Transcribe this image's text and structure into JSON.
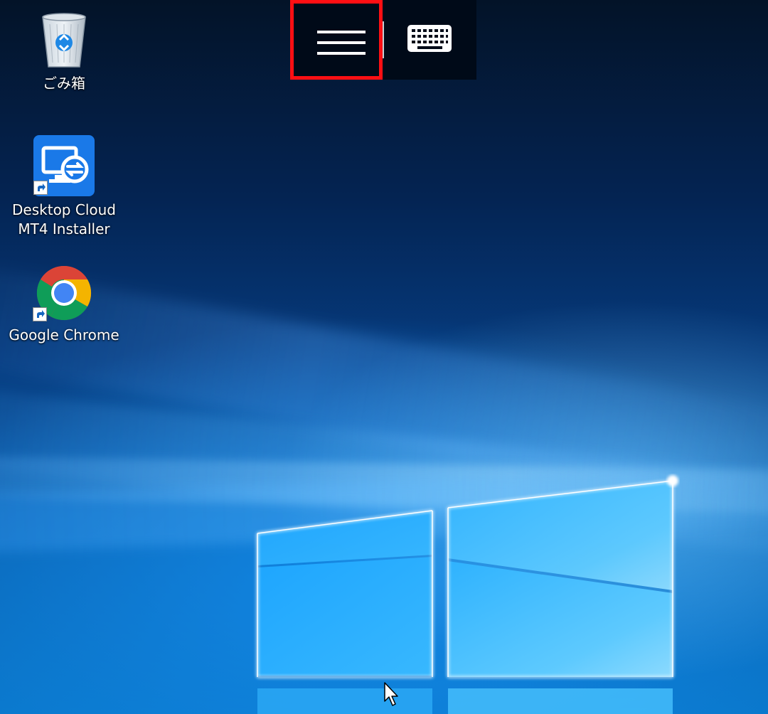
{
  "desktop": {
    "icons": [
      {
        "id": "recycle-bin",
        "label": "ごみ箱",
        "icon": "recycle-bin-icon"
      },
      {
        "id": "desktop-cloud-mt4",
        "label": "Desktop Cloud\nMT4 Installer",
        "icon": "desktop-cloud-installer-icon"
      },
      {
        "id": "google-chrome",
        "label": "Google Chrome",
        "icon": "chrome-icon"
      }
    ]
  },
  "toolbar": {
    "buttons": [
      {
        "id": "menu",
        "icon": "hamburger-menu-icon",
        "highlighted": true,
        "highlight_color": "#ff0f13"
      },
      {
        "id": "keyboard",
        "icon": "keyboard-icon"
      }
    ]
  },
  "colors": {
    "toolbar_background": "#000a18",
    "highlight": "#ff0f13",
    "wallpaper_accent": "#0a78cc"
  }
}
